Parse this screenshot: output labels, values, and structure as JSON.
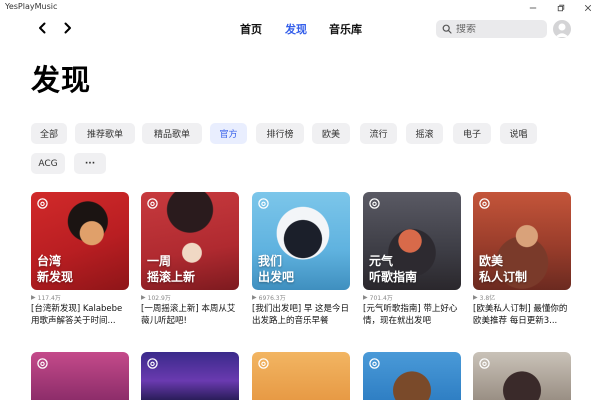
{
  "app": {
    "title": "YesPlayMusic"
  },
  "nav": {
    "tabs": [
      {
        "label": "首页",
        "active": false
      },
      {
        "label": "发现",
        "active": true
      },
      {
        "label": "音乐库",
        "active": false
      }
    ],
    "search": {
      "placeholder": "搜索"
    }
  },
  "page": {
    "title": "发现"
  },
  "categories": [
    "全部",
    "推荐歌单",
    "精品歌单",
    "官方",
    "排行榜",
    "欧美",
    "流行",
    "摇滚",
    "电子",
    "说唱",
    "ACG",
    "···"
  ],
  "active_category": "官方",
  "playlists": [
    {
      "cover_text": "台湾\n新发现",
      "play_count": "117.4万",
      "name": "[台湾新发现] Kalabebe 用歌声解答关于时间..."
    },
    {
      "cover_text": "一周\n摇滚上新",
      "play_count": "102.9万",
      "name": "[一周摇滚上新] 本周从艾薇儿听起吧!"
    },
    {
      "cover_text": "我们\n出发吧",
      "play_count": "6976.3万",
      "name": "[我们出发吧] 早 这是今日出发路上的音乐早餐"
    },
    {
      "cover_text": "元气\n听歌指南",
      "play_count": "701.4万",
      "name": "[元气听歌指南] 带上好心情，现在就出发吧"
    },
    {
      "cover_text": "欧美\n私人订制",
      "play_count": "3.8亿",
      "name": "[欧美私人订制] 最懂你的欧美推荐 每日更新3..."
    }
  ],
  "colors": {
    "accent": "#335eea"
  }
}
